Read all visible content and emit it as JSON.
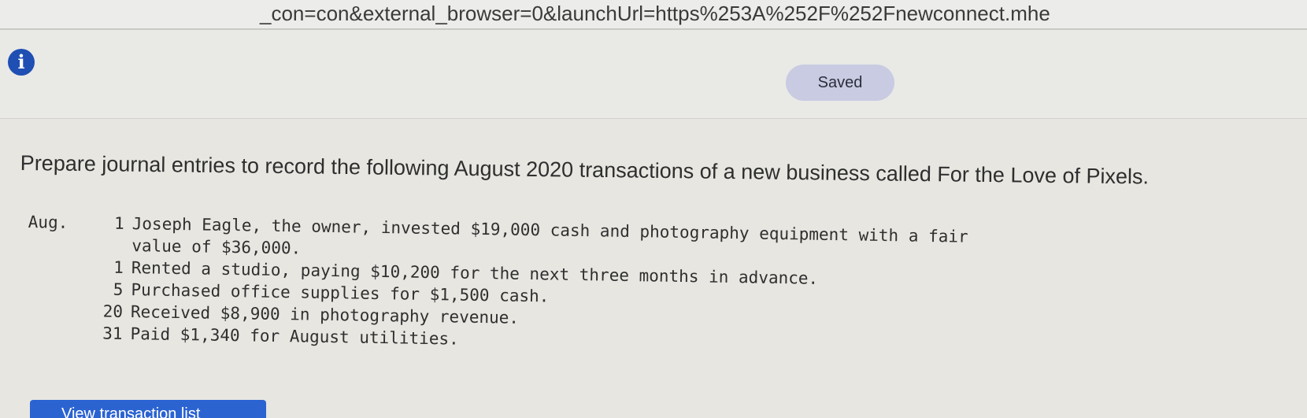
{
  "browser": {
    "url": "_con=con&external_browser=0&launchUrl=https%253A%252F%252Fnewconnect.mhe"
  },
  "header": {
    "info_icon": "i",
    "saved_label": "Saved"
  },
  "question": {
    "prompt": "Prepare journal entries to record the following August 2020 transactions of a new business called For the Love of Pixels.",
    "month": "Aug.",
    "transactions": [
      {
        "day": "1",
        "lines": [
          "Joseph Eagle, the owner, invested $19,000 cash and photography equipment with a fair",
          "value of $36,000."
        ]
      },
      {
        "day": "1",
        "lines": [
          "Rented a studio, paying $10,200 for the next three months in advance."
        ]
      },
      {
        "day": "5",
        "lines": [
          "Purchased office supplies for $1,500 cash."
        ]
      },
      {
        "day": "20",
        "lines": [
          "Received $8,900 in photography revenue."
        ]
      },
      {
        "day": "31",
        "lines": [
          "Paid $1,340 for August utilities."
        ]
      }
    ]
  },
  "actions": {
    "view_button_label": "View transaction list"
  },
  "colors": {
    "info_icon_bg": "#1f4fb3",
    "saved_badge_bg": "#c8cbe2",
    "primary_button": "#2b63d1"
  },
  "icons": {
    "info": "info-icon"
  }
}
